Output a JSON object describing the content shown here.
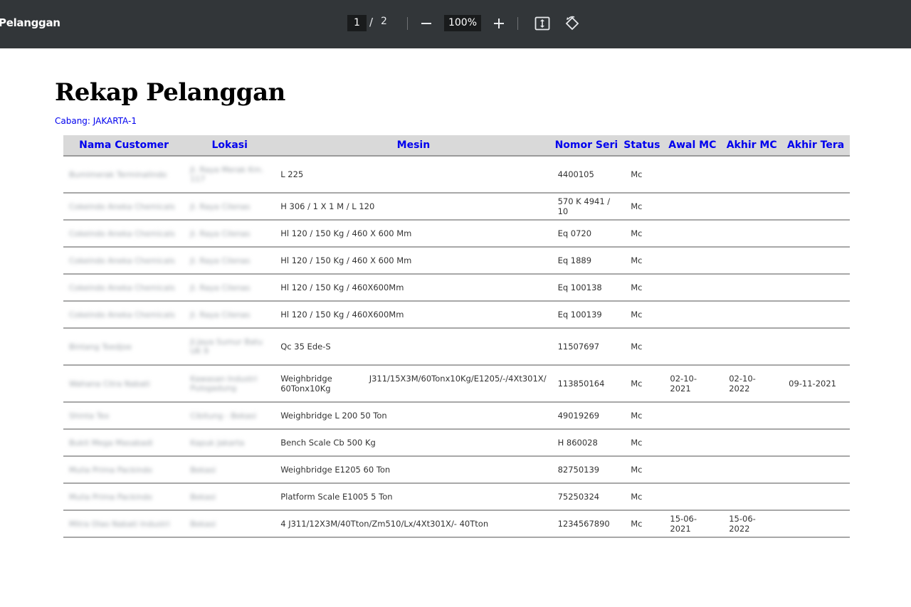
{
  "toolbar": {
    "title": "Pelanggan",
    "current_page": "1",
    "page_separator": "/",
    "total_pages": "2",
    "zoom": "100%",
    "icons": [
      "minus-icon",
      "plus-icon",
      "fit-page-icon",
      "rotate-icon"
    ]
  },
  "document": {
    "heading": "Rekap Pelanggan",
    "branch": "Cabang: JAKARTA-1"
  },
  "table": {
    "headers": [
      "Nama Customer",
      "Lokasi",
      "Mesin",
      "Nomor Seri",
      "Status",
      "Awal MC",
      "Akhir MC",
      "Akhir Tera"
    ],
    "rows": [
      {
        "customer": "Bumimerak Terminalindo",
        "lokasi": "Jl. Raya Merak Km. 117",
        "mesin": "L 225",
        "seri": "4400105",
        "status": "Mc",
        "awal": "",
        "akhir": "",
        "tera": ""
      },
      {
        "customer": "Cokeindo Aneka Chemicals",
        "lokasi": "Jl. Raya Cilenas",
        "mesin": "H 306 / 1 X 1 M / L 120",
        "seri": "570 K 4941 / 10",
        "status": "Mc",
        "awal": "",
        "akhir": "",
        "tera": ""
      },
      {
        "customer": "Cokeindo Aneka Chemicals",
        "lokasi": "Jl. Raya Cilenas",
        "mesin": "Hl 120 / 150 Kg / 460 X 600 Mm",
        "seri": "Eq 0720",
        "status": "Mc",
        "awal": "",
        "akhir": "",
        "tera": ""
      },
      {
        "customer": "Cokeindo Aneka Chemicals",
        "lokasi": "Jl. Raya Cilenas",
        "mesin": "Hl 120 / 150 Kg / 460 X 600 Mm",
        "seri": "Eq 1889",
        "status": "Mc",
        "awal": "",
        "akhir": "",
        "tera": ""
      },
      {
        "customer": "Cokeindo Aneka Chemicals",
        "lokasi": "Jl. Raya Cilenas",
        "mesin": "Hl 120 / 150 Kg / 460X600Mm",
        "seri": "Eq 100138",
        "status": "Mc",
        "awal": "",
        "akhir": "",
        "tera": ""
      },
      {
        "customer": "Cokeindo Aneka Chemicals",
        "lokasi": "Jl. Raya Cilenas",
        "mesin": "Hl 120 / 150 Kg / 460X600Mm",
        "seri": "Eq 100139",
        "status": "Mc",
        "awal": "",
        "akhir": "",
        "tera": ""
      },
      {
        "customer": "Bintang Toedjoe",
        "lokasi": "Jl.Jaya Sumur Batu UK 9",
        "mesin": "Qc 35 Ede-S",
        "seri": "11507697",
        "status": "Mc",
        "awal": "",
        "akhir": "",
        "tera": ""
      },
      {
        "customer": "Wahana Citra Nabati",
        "lokasi": "Kawasan Industri Pulogadung",
        "mesin": "Weighbridge J311/15X3M/60Tonx10Kg/E1205/-/4Xt301X/ 60Tonx10Kg",
        "seri": "113850164",
        "status": "Mc",
        "awal": "02-10-2021",
        "akhir": "02-10-2022",
        "tera": "09-11-2021"
      },
      {
        "customer": "Shinta Tex",
        "lokasi": "Cibitung - Bekasi",
        "mesin": "Weighbridge L 200 50 Ton",
        "seri": "49019269",
        "status": "Mc",
        "awal": "",
        "akhir": "",
        "tera": ""
      },
      {
        "customer": "Bukit Mega Masabadi",
        "lokasi": "Kapuk Jakarta",
        "mesin": "Bench Scale Cb 500 Kg",
        "seri": "H 860028",
        "status": "Mc",
        "awal": "",
        "akhir": "",
        "tera": ""
      },
      {
        "customer": "Mulia Prima Packindo",
        "lokasi": "Bekasi",
        "mesin": "Weighbridge E1205 60 Ton",
        "seri": "82750139",
        "status": "Mc",
        "awal": "",
        "akhir": "",
        "tera": ""
      },
      {
        "customer": "Mulia Prima Packindo",
        "lokasi": "Bekasi",
        "mesin": "Platform Scale E1005 5 Ton",
        "seri": "75250324",
        "status": "Mc",
        "awal": "",
        "akhir": "",
        "tera": ""
      },
      {
        "customer": "Mitra Olao Nabati Industri",
        "lokasi": "Bekasi",
        "mesin": "4 J311/12X3M/40Tton/Zm510/Lx/4Xt301X/- 40Tton",
        "seri": "1234567890",
        "status": "Mc",
        "awal": "15-06-2021",
        "akhir": "15-06-2022",
        "tera": ""
      }
    ]
  }
}
